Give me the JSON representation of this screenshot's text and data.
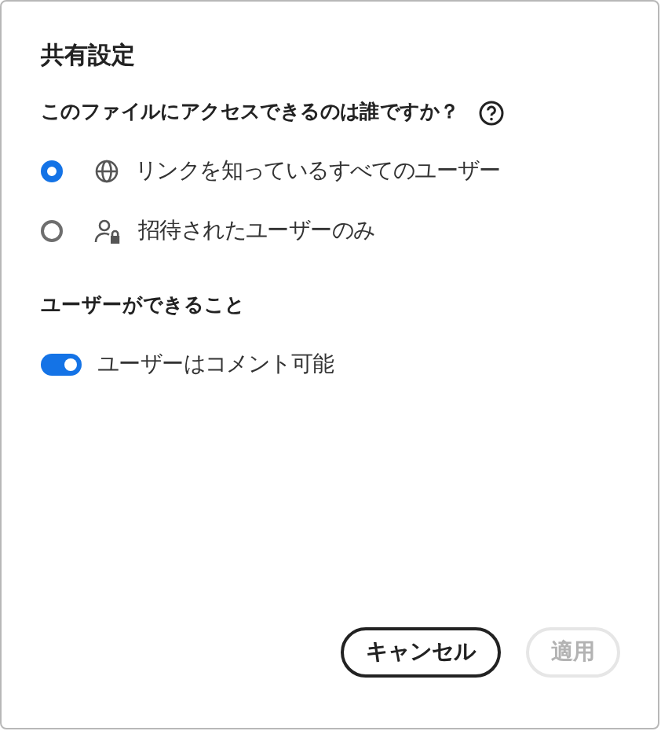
{
  "dialog": {
    "title": "共有設定"
  },
  "question": {
    "text": "このファイルにアクセスできるのは誰ですか？"
  },
  "options": [
    {
      "label": "リンクを知っているすべてのユーザー",
      "selected": true,
      "kind": "globe"
    },
    {
      "label": "招待されたユーザーのみ",
      "selected": false,
      "kind": "user-lock"
    }
  ],
  "permissions": {
    "heading": "ユーザーができること",
    "toggles": [
      {
        "label": "ユーザーはコメント可能",
        "on": true
      }
    ]
  },
  "buttons": [
    {
      "label": "キャンセル",
      "disabled": false
    },
    {
      "label": "適用",
      "disabled": true
    }
  ]
}
